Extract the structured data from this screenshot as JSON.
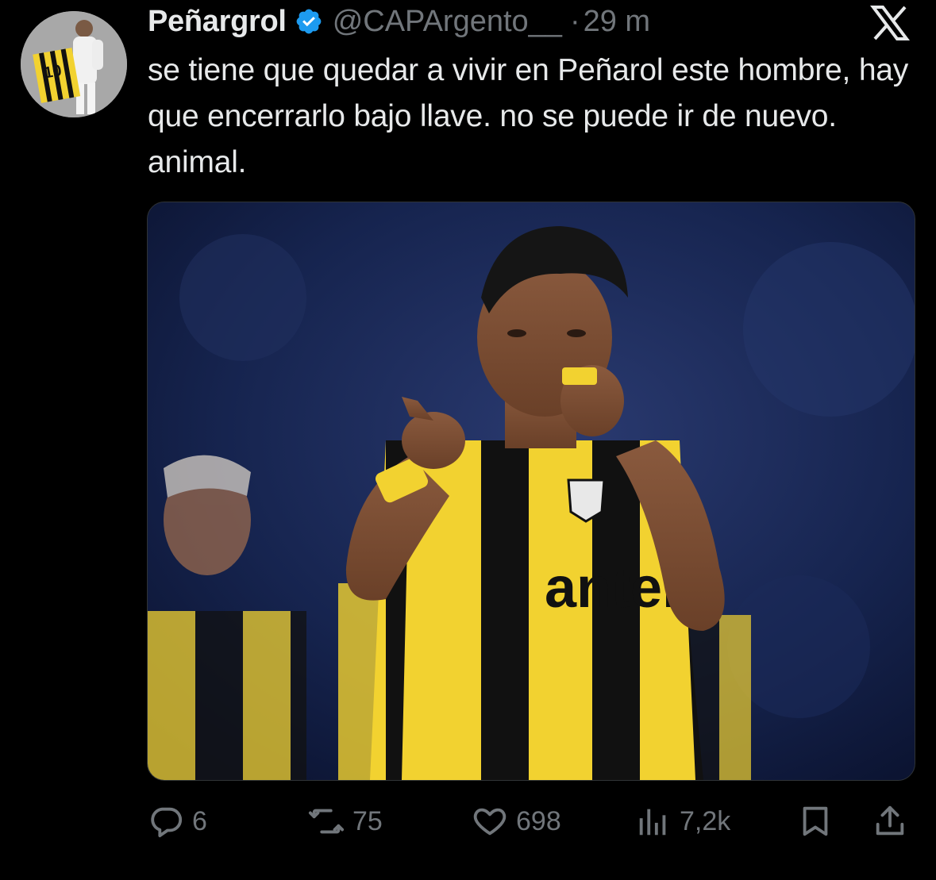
{
  "tweet": {
    "display_name": "Peñargrol",
    "handle": "@CAPArgento__",
    "separator": "·",
    "time": "29 m",
    "text": "se tiene que quedar a vivir en Peñarol este hombre, hay que encerrarlo bajo llave. no se puede ir de nuevo. animal.",
    "media_jersey_sponsor": "antel"
  },
  "actions": {
    "replies": "6",
    "reposts": "75",
    "likes": "698",
    "views": "7,2k"
  },
  "icons": {
    "verified": "verified-badge-icon",
    "platform": "x-logo-icon",
    "reply": "reply-icon",
    "repost": "repost-icon",
    "like": "heart-icon",
    "views": "views-icon",
    "bookmark": "bookmark-icon",
    "share": "share-icon"
  },
  "colors": {
    "background": "#000000",
    "text": "#e7e9ea",
    "muted": "#71767b",
    "verified": "#1d9bf0",
    "jersey_yellow": "#f2d230",
    "jersey_black": "#111111"
  }
}
